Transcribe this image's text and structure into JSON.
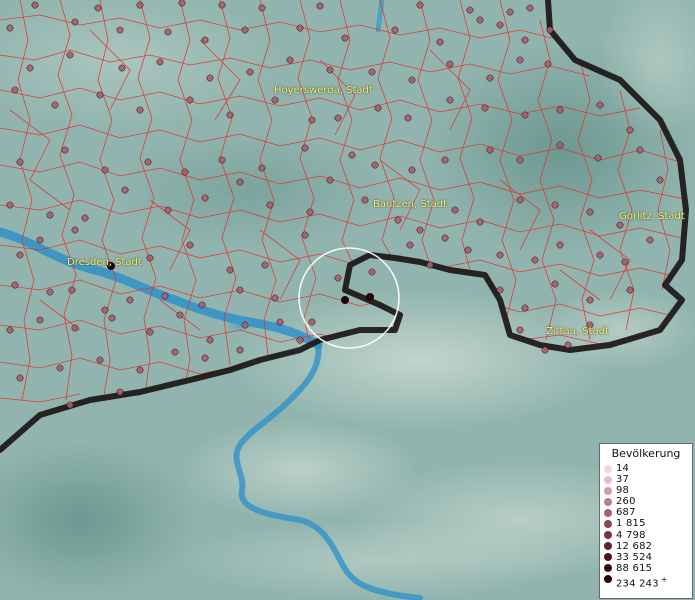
{
  "map": {
    "labels": [
      {
        "text": "Hoyerswerda, Stadt"
      },
      {
        "text": "Bautzen, Stadt"
      },
      {
        "text": "Görlitz, Stadt"
      },
      {
        "text": "Dresden, Stadt"
      },
      {
        "text": "Zittau, Stadt"
      }
    ],
    "colors": {
      "terrain": "#8fb3ad",
      "municipality_border": "#e0322f",
      "national_border": "#1a1313",
      "river": "#2b8fc9",
      "marker_outline": "#3a1416"
    }
  },
  "legend": {
    "title": "Bevölkerung",
    "items": [
      {
        "label": "14",
        "color": "#f6d5df"
      },
      {
        "label": "37",
        "color": "#e8b9c6"
      },
      {
        "label": "98",
        "color": "#d49aa8"
      },
      {
        "label": "260",
        "color": "#bf7b8b"
      },
      {
        "label": "687",
        "color": "#a85e6e"
      },
      {
        "label": "1 815",
        "color": "#904555"
      },
      {
        "label": "4 798",
        "color": "#7a3040"
      },
      {
        "label": "12 682",
        "color": "#64202c"
      },
      {
        "label": "33 524",
        "color": "#4d141d"
      },
      {
        "label": "88 615",
        "color": "#370a12"
      },
      {
        "label": "234 243",
        "color": "#200407",
        "plus": "+"
      }
    ]
  }
}
